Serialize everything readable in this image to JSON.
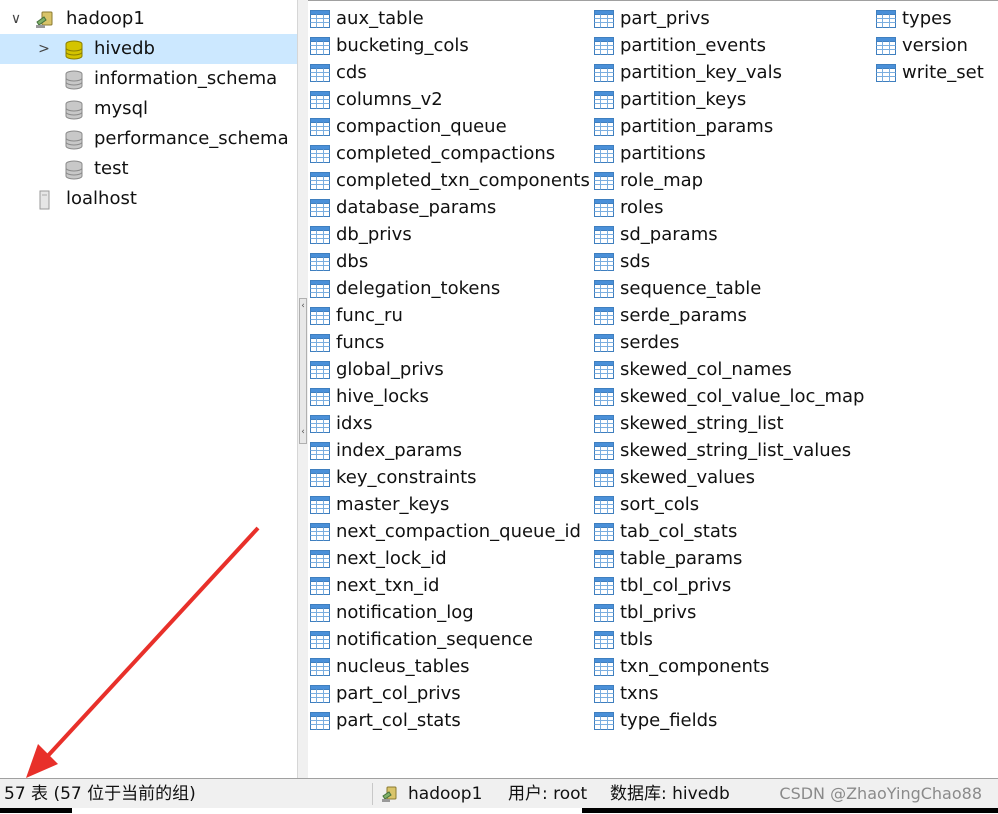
{
  "tree": {
    "items": [
      {
        "label": "hadoop1",
        "toggle": "∨",
        "type": "connection",
        "expanded": true
      },
      {
        "label": "hivedb",
        "toggle": ">",
        "type": "database-open",
        "selected": true
      },
      {
        "label": "information_schema",
        "type": "database"
      },
      {
        "label": "mysql",
        "type": "database"
      },
      {
        "label": "performance_schema",
        "type": "database"
      },
      {
        "label": "test",
        "type": "database"
      },
      {
        "label": "loalhost",
        "type": "connection-closed"
      }
    ]
  },
  "tables": {
    "columns": [
      [
        "aux_table",
        "bucketing_cols",
        "cds",
        "columns_v2",
        "compaction_queue",
        "completed_compactions",
        "completed_txn_components",
        "database_params",
        "db_privs",
        "dbs",
        "delegation_tokens",
        "func_ru",
        "funcs",
        "global_privs",
        "hive_locks",
        "idxs",
        "index_params",
        "key_constraints",
        "master_keys",
        "next_compaction_queue_id",
        "next_lock_id",
        "next_txn_id",
        "notification_log",
        "notification_sequence",
        "nucleus_tables",
        "part_col_privs",
        "part_col_stats"
      ],
      [
        "part_privs",
        "partition_events",
        "partition_key_vals",
        "partition_keys",
        "partition_params",
        "partitions",
        "role_map",
        "roles",
        "sd_params",
        "sds",
        "sequence_table",
        "serde_params",
        "serdes",
        "skewed_col_names",
        "skewed_col_value_loc_map",
        "skewed_string_list",
        "skewed_string_list_values",
        "skewed_values",
        "sort_cols",
        "tab_col_stats",
        "table_params",
        "tbl_col_privs",
        "tbl_privs",
        "tbls",
        "txn_components",
        "txns",
        "type_fields"
      ],
      [
        "types",
        "version",
        "write_set"
      ]
    ]
  },
  "statusbar": {
    "count_text": "57 表 (57 位于当前的组)",
    "connection": "hadoop1",
    "user": "用户: root",
    "database": "数据库: hivedb",
    "watermark": "CSDN @ZhaoYingChao88"
  },
  "colors": {
    "selection": "#cce8ff",
    "arrow": "#e8302a",
    "db_active": "#d4c400"
  }
}
